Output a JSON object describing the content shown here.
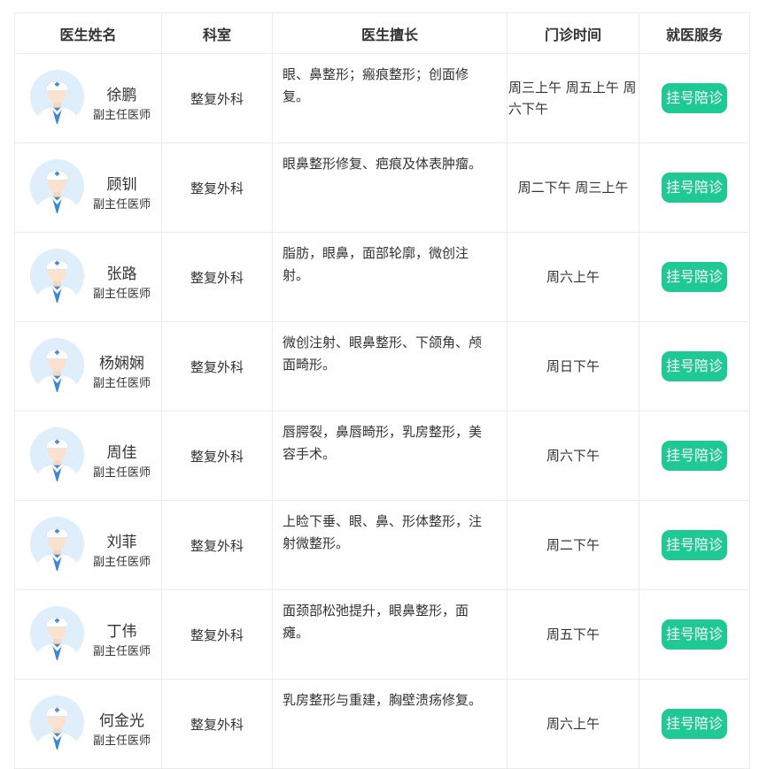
{
  "headers": {
    "name": "医生姓名",
    "dept": "科室",
    "specialty": "医生擅长",
    "schedule": "门诊时间",
    "service": "就医服务"
  },
  "colors": {
    "button": "#1fc994",
    "border": "#ececec",
    "avatar_bg": "#dfeefb",
    "coat": "#3e86d6"
  },
  "rows": [
    {
      "name": "徐鹏",
      "title": "副主任医师",
      "dept": "整复外科",
      "specialty": "眼、鼻整形；瘢痕整形；创面修复。",
      "schedule": "周三上午 周五上午 周六下午",
      "button": "挂号陪诊",
      "avatar_icon": "doctor-avatar-icon"
    },
    {
      "name": "顾钏",
      "title": "副主任医师",
      "dept": "整复外科",
      "specialty": "眼鼻整形修复、疤痕及体表肿瘤。",
      "schedule": "周二下午 周三上午",
      "button": "挂号陪诊",
      "avatar_icon": "doctor-avatar-icon"
    },
    {
      "name": "张路",
      "title": "副主任医师",
      "dept": "整复外科",
      "specialty": "脂肪，眼鼻，面部轮廓，微创注射。",
      "schedule": "周六上午",
      "button": "挂号陪诊",
      "avatar_icon": "doctor-avatar-icon"
    },
    {
      "name": "杨娴娴",
      "title": "副主任医师",
      "dept": "整复外科",
      "specialty": "微创注射、眼鼻整形、下颌角、颅面畸形。",
      "schedule": "周日下午",
      "button": "挂号陪诊",
      "avatar_icon": "doctor-avatar-icon"
    },
    {
      "name": "周佳",
      "title": "副主任医师",
      "dept": "整复外科",
      "specialty": "唇腭裂，鼻唇畸形，乳房整形，美容手术。",
      "schedule": "周六下午",
      "button": "挂号陪诊",
      "avatar_icon": "doctor-avatar-icon"
    },
    {
      "name": "刘菲",
      "title": "副主任医师",
      "dept": "整复外科",
      "specialty": "上睑下垂、眼、鼻、形体整形，注射微整形。",
      "schedule": "周二下午",
      "button": "挂号陪诊",
      "avatar_icon": "doctor-avatar-icon"
    },
    {
      "name": "丁伟",
      "title": "副主任医师",
      "dept": "整复外科",
      "specialty": "面颈部松弛提升，眼鼻整形，面瘫。",
      "schedule": "周五下午",
      "button": "挂号陪诊",
      "avatar_icon": "doctor-avatar-icon"
    },
    {
      "name": "何金光",
      "title": "副主任医师",
      "dept": "整复外科",
      "specialty": "乳房整形与重建，胸壁溃疡修复。",
      "schedule": "周六上午",
      "button": "挂号陪诊",
      "avatar_icon": "doctor-avatar-icon"
    }
  ]
}
